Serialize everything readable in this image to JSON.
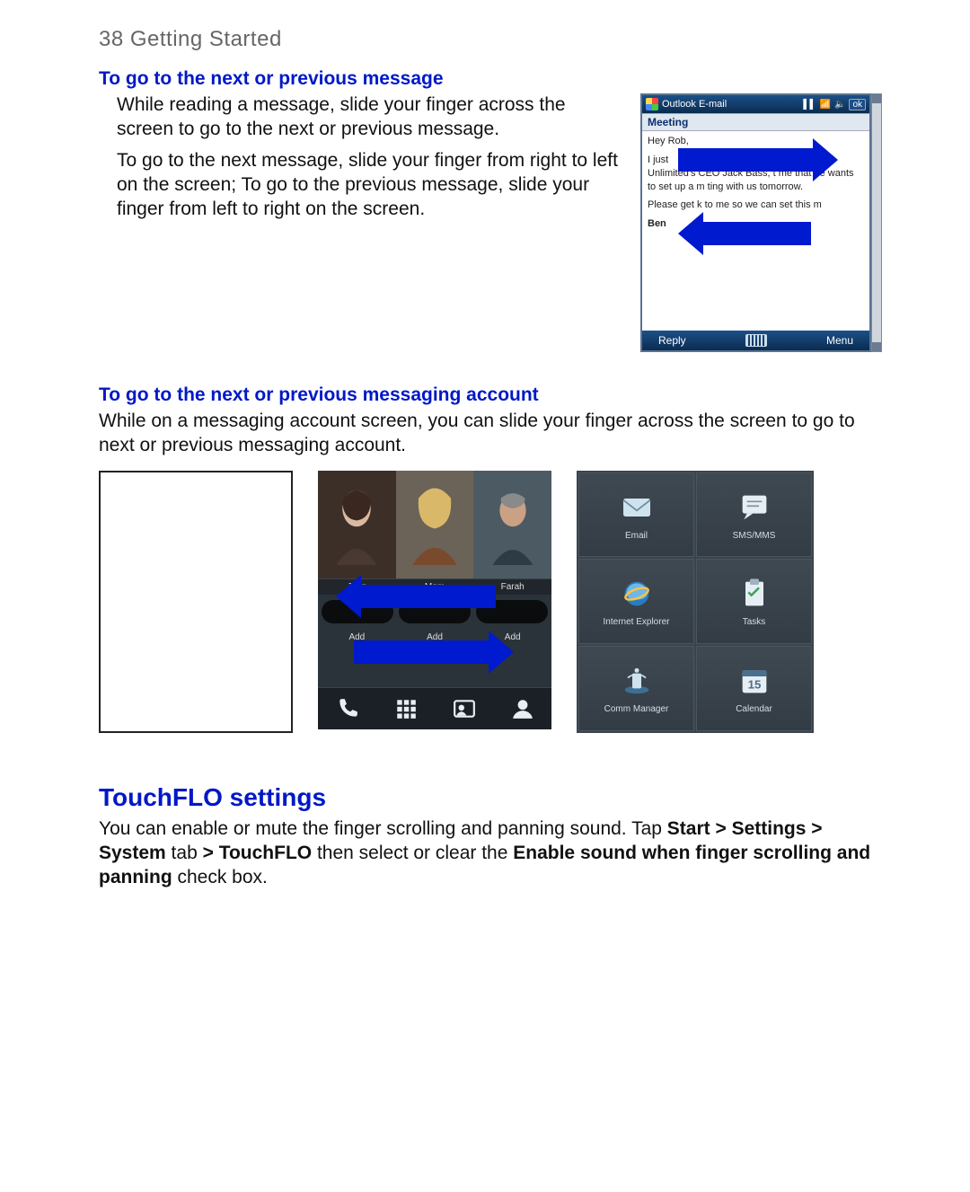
{
  "page_header": "38  Getting Started",
  "sec1": {
    "heading": "To go to the next or previous message",
    "para1": "While reading a message, slide your finger across the screen to go to the next or previous message.",
    "para2": "To go to the next message, slide your finger from right to left on the screen; To go to the previous message, slide your finger from left to right on the screen."
  },
  "phone_email": {
    "app_title": "Outlook E-mail",
    "ok": "ok",
    "subject": "Meeting",
    "greeting": "Hey Rob,",
    "body_line2_a": "I just",
    "body_line3": "Unlimited's CEO Jack Bass, t",
    "body_line3b": "me that he wants to set up a m",
    "body_line3c": "ting with us tomorrow.",
    "body_line4a": "Please get",
    "body_line4b": "k to me so we can set this m",
    "signature": "Ben",
    "reply": "Reply",
    "menu": "Menu"
  },
  "sec2": {
    "heading": "To go to the next or previous messaging account",
    "para": "While on a messaging account screen, you can slide your finger across the screen to go to next or previous messaging account."
  },
  "contacts": {
    "names": [
      "Joan",
      "Mom",
      "Farah"
    ],
    "add": [
      "Add",
      "Add",
      "Add"
    ]
  },
  "programs": {
    "items": [
      {
        "label": "Email",
        "icon": "email"
      },
      {
        "label": "SMS/MMS",
        "icon": "sms"
      },
      {
        "label": "Internet Explorer",
        "icon": "ie"
      },
      {
        "label": "Tasks",
        "icon": "tasks"
      },
      {
        "label": "Comm Manager",
        "icon": "comm"
      },
      {
        "label": "Calendar",
        "icon": "calendar"
      }
    ]
  },
  "touchflo": {
    "heading": "TouchFLO settings",
    "p1a": "You can enable or mute the finger scrolling and panning sound. Tap ",
    "p1b": "Start > Settings > System",
    "p1c": " tab ",
    "p1d": "> TouchFLO",
    "p1e": " then select or clear the ",
    "p1f": "Enable sound when finger scrolling and panning",
    "p1g": " check box."
  }
}
